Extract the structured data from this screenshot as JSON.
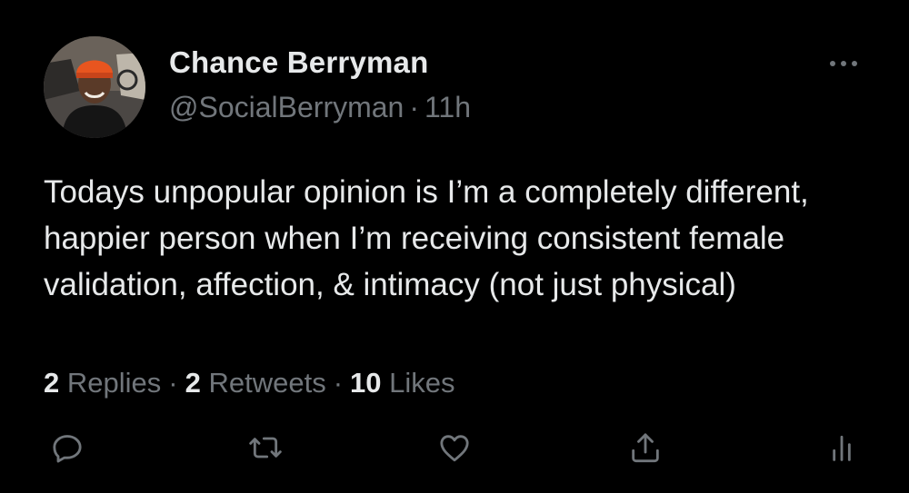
{
  "tweet": {
    "author": {
      "display_name": "Chance Berryman",
      "handle": "@SocialBerryman",
      "avatar_icon": "user-avatar-photo"
    },
    "time_ago": "11h",
    "separator": "·",
    "more_icon": "more-horizontal-icon",
    "text": "Todays unpopular opinion is I’m a completely different, happier person when I’m receiving consistent female validation, affection, & intimacy (not just physical)",
    "stats": {
      "replies_count": "2",
      "replies_label": "Replies",
      "retweets_count": "2",
      "retweets_label": "Retweets",
      "likes_count": "10",
      "likes_label": "Likes"
    },
    "actions": {
      "reply_icon": "reply-icon",
      "retweet_icon": "retweet-icon",
      "like_icon": "heart-icon",
      "share_icon": "share-icon",
      "analytics_icon": "analytics-icon"
    }
  },
  "colors": {
    "background": "#000000",
    "primary_text": "#e7e9ea",
    "secondary_text": "#71767b"
  }
}
